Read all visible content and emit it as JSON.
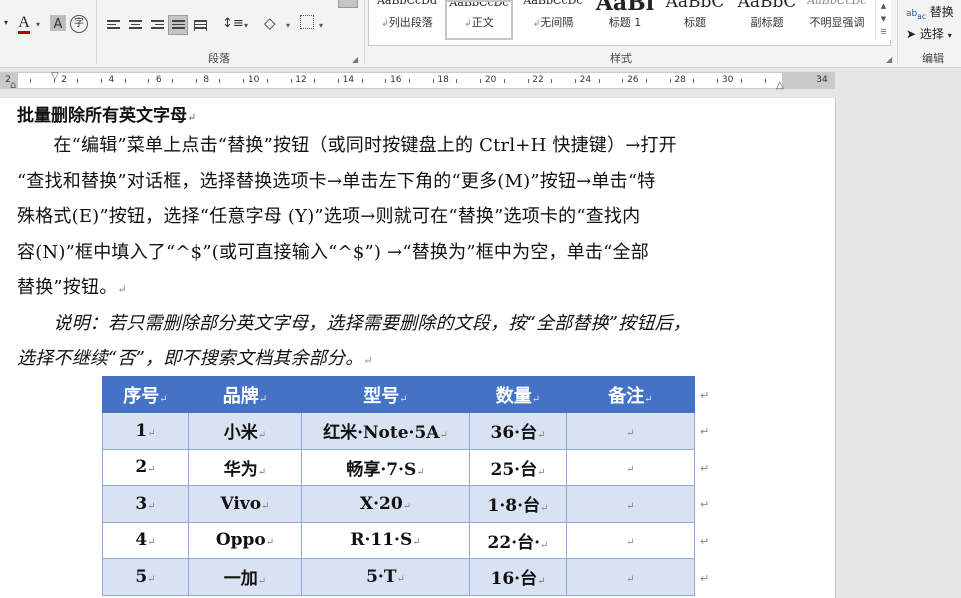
{
  "ribbon": {
    "groups": {
      "paragraph": "段落",
      "styles": "样式",
      "editing": "编辑"
    },
    "styles": [
      {
        "sample": "AaBbCcDd",
        "name": "列出段落",
        "prefix": "↲"
      },
      {
        "sample": "AaBbCcDc",
        "name": "正文",
        "prefix": "↲"
      },
      {
        "sample": "AaBbCcDc",
        "name": "无间隔",
        "prefix": "↲"
      },
      {
        "sample": "AaBl",
        "name": "标题 1",
        "prefix": ""
      },
      {
        "sample": "AaBbC",
        "name": "标题",
        "prefix": ""
      },
      {
        "sample": "AaBbC",
        "name": "副标题",
        "prefix": ""
      },
      {
        "sample": "AaBbCcDc",
        "name": "不明显强调",
        "prefix": ""
      }
    ],
    "editing": {
      "replace": "替换",
      "select": "选择"
    },
    "font_color_letter": "A",
    "highlight_letter": "A",
    "accent": "#c00000"
  },
  "ruler": {
    "numbers": [
      "2",
      "2",
      "4",
      "6",
      "8",
      "10",
      "12",
      "14",
      "16",
      "18",
      "20",
      "22",
      "24",
      "26",
      "28",
      "30",
      "34"
    ]
  },
  "doc": {
    "title": "批量删除所有英文字母",
    "lines": [
      "　　在“编辑”菜单上点击“替换”按钮（或同时按键盘上的 Ctrl+H 快捷键）→打开",
      "“查找和替换”对话框，选择替换选项卡→单击左下角的“更多(M)”按钮→单击“特",
      "殊格式(E)”按钮，选择“任意字母 (Y)”选项→则就可在“替换”选项卡的“查找内",
      "容(N)”框中填入了“^$”(或可直接输入“^$”) →“替换为”框中为空，单击“全部",
      "替换”按钮。"
    ],
    "note_lines": [
      "　　说明：若只需删除部分英文字母，选择需要删除的文段，按“全部替换”按钮后，",
      "选择不继续“否”，即不搜索文档其余部分。"
    ],
    "table": {
      "headers": [
        "序号",
        "品牌",
        "型号",
        "数量",
        "备注"
      ],
      "rows": [
        [
          "1",
          "小米",
          "红米·Note·5A",
          "36·台",
          ""
        ],
        [
          "2",
          "华为",
          "畅享·7·S",
          "25·台",
          ""
        ],
        [
          "3",
          "Vivo",
          "X·20",
          "1·8·台",
          ""
        ],
        [
          "4",
          "Oppo",
          "R·11·S",
          "22·台·",
          ""
        ],
        [
          "5",
          "一加",
          "5·T",
          "16·台",
          ""
        ]
      ],
      "header_color": "#4472c4",
      "band_color": "#d9e2f3"
    },
    "para_mark": "↵"
  }
}
